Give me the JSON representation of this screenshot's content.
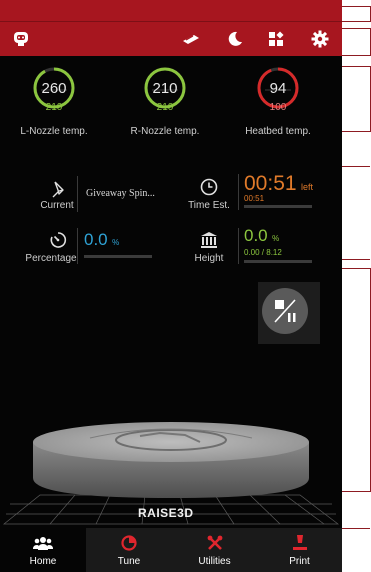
{
  "header": {
    "icons": [
      "robot-icon",
      "filament-icon",
      "moon-icon",
      "apps-icon",
      "gear-icon"
    ]
  },
  "temps": [
    {
      "current": "260",
      "target": "210",
      "label": "L-Nozzle temp.",
      "color": "#8cc63f",
      "fill": 0.92
    },
    {
      "current": "210",
      "target": "210",
      "label": "R-Nozzle temp.",
      "color": "#8cc63f",
      "fill": 1.0
    },
    {
      "current": "94",
      "target": "100",
      "label": "Heatbed temp.",
      "color": "#d62a2a",
      "fill": 0.94
    }
  ],
  "info": {
    "current_label": "Current",
    "current_value": "Giveaway Spin...",
    "time_label": "Time Est.",
    "time_value": "00:51",
    "time_suffix": "left",
    "time_sub": "00:51",
    "percentage_label": "Percentage",
    "percentage_value": "0.0",
    "percentage_unit": "%",
    "percentage_fill": 0.0,
    "height_label": "Height",
    "height_value": "0.0",
    "height_unit": "%",
    "height_sub": "0.00 / 8.12",
    "height_fill": 0.0
  },
  "brand": "RAISE3D",
  "nav": [
    {
      "label": "Home",
      "icon": "home-users-icon",
      "active": true
    },
    {
      "label": "Tune",
      "icon": "tune-icon",
      "active": false
    },
    {
      "label": "Utilities",
      "icon": "utilities-icon",
      "active": false
    },
    {
      "label": "Print",
      "icon": "print-icon",
      "active": false
    }
  ],
  "colors": {
    "brand_red": "#a7161f",
    "green": "#8cc63f",
    "orange": "#e07a2a",
    "cyan": "#2fa3d6",
    "nav_bg": "#1a1a1a",
    "nav_active": "#050505"
  }
}
